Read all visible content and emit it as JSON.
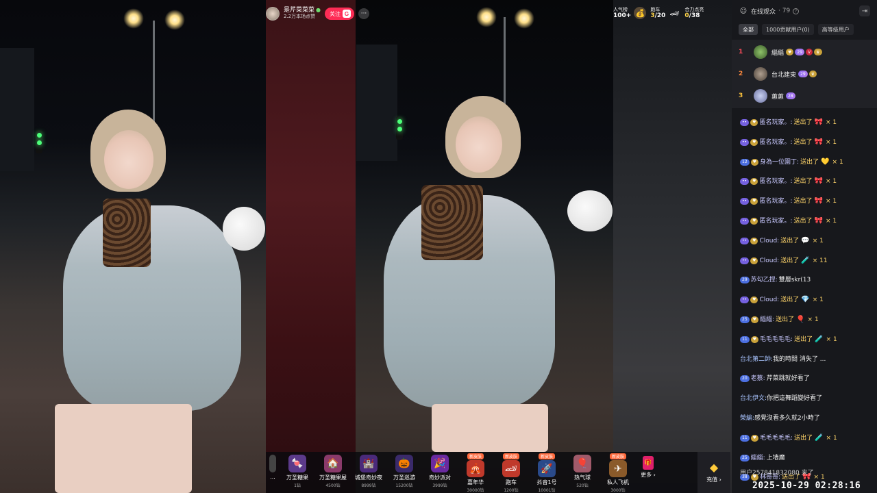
{
  "host": {
    "name": "是芹菜菜菜",
    "likes": "2.2万本场点赞",
    "follow_label": "关注",
    "follow_badge": "G"
  },
  "stats": {
    "popularity_label": "人气榜",
    "popularity_value": "100+",
    "car_label": "跑车",
    "car_value_current": "3",
    "car_value_total": "/20",
    "collab_label": "合力点亮",
    "collab_value_current": "0",
    "collab_value_total": "/38"
  },
  "gifts": [
    {
      "name": "...",
      "price": "",
      "icon": "gift-icon",
      "new": false
    },
    {
      "name": "万圣糖果",
      "price": "1钻",
      "icon": "candy-icon",
      "new": false
    },
    {
      "name": "万圣糖果屋",
      "price": "4500钻",
      "icon": "candy-house-icon",
      "new": false
    },
    {
      "name": "城堡奇妙夜",
      "price": "8999钻",
      "icon": "castle-icon",
      "new": false
    },
    {
      "name": "万圣巡游",
      "price": "15200钻",
      "icon": "parade-icon",
      "new": false
    },
    {
      "name": "奇妙派对",
      "price": "3999钻",
      "icon": "party-icon",
      "new": false
    },
    {
      "name": "嘉年华",
      "price": "30000钻",
      "icon": "carnival-icon",
      "new": true
    },
    {
      "name": "跑车",
      "price": "1200钻",
      "icon": "car-icon",
      "new": true
    },
    {
      "name": "抖音1号",
      "price": "10001钻",
      "icon": "rocket-icon",
      "new": true
    },
    {
      "name": "热气球",
      "price": "520钻",
      "icon": "balloon-icon",
      "new": false
    },
    {
      "name": "私人飞机",
      "price": "3000钻",
      "icon": "plane-icon",
      "new": true
    }
  ],
  "gift_new_label": "新皮肤",
  "more_label": "更多",
  "recharge_label": "充值",
  "panel": {
    "title": "在线观众",
    "count": "· 79",
    "tabs": [
      "全部",
      "1000贡献用户(0)",
      "高等级用户"
    ],
    "ranks": [
      {
        "num": "1",
        "name": "緇緇",
        "badge": "29"
      },
      {
        "num": "2",
        "name": "台北建東",
        "badge": "29"
      },
      {
        "num": "3",
        "name": "蕙蕙",
        "badge": "28"
      }
    ]
  },
  "chat": [
    {
      "name": "匿名玩家。:",
      "act": "送出了",
      "gift": "🎀",
      "count": "× 1",
      "lv": ""
    },
    {
      "name": "匿名玩家。:",
      "act": "送出了",
      "gift": "🎀",
      "count": "× 1",
      "lv": ""
    },
    {
      "name": "身為一位園丁:",
      "act": "送出了",
      "gift": "💛",
      "count": "× 1",
      "lv": "12"
    },
    {
      "name": "匿名玩家。:",
      "act": "送出了",
      "gift": "🎀",
      "count": "× 1",
      "lv": ""
    },
    {
      "name": "匿名玩家。:",
      "act": "送出了",
      "gift": "🎀",
      "count": "× 1",
      "lv": ""
    },
    {
      "name": "匿名玩家。:",
      "act": "送出了",
      "gift": "🎀",
      "count": "× 1",
      "lv": ""
    },
    {
      "name": "Cloud:",
      "act": "送出了",
      "gift": "💬",
      "count": "× 1",
      "lv": ""
    },
    {
      "name": "Cloud:",
      "act": "送出了",
      "gift": "🧪",
      "count": "× 11",
      "lv": ""
    },
    {
      "name": "苏勾乙捏:",
      "act": "",
      "gift": "",
      "count": "",
      "text": "雙層skr(13",
      "lv": "29"
    },
    {
      "name": "Cloud:",
      "act": "送出了",
      "gift": "💎",
      "count": "× 1",
      "lv": ""
    },
    {
      "name": "緇緇:",
      "act": "送出了",
      "gift": "🎈",
      "count": "× 1",
      "lv": "25"
    },
    {
      "name": "毛毛毛毛毛:",
      "act": "送出了",
      "gift": "🧪",
      "count": "× 1",
      "lv": "11"
    },
    {
      "name": "台北第二帥:",
      "act": "",
      "gift": "",
      "count": "",
      "text": "我的時間 消失了 ...",
      "lv": "plain"
    },
    {
      "name": "老蔡:",
      "act": "",
      "gift": "",
      "count": "",
      "text": "芹菜跳就好看了",
      "lv": "20"
    },
    {
      "name": "台北伊文:",
      "act": "",
      "gift": "",
      "count": "",
      "text": "你把這舞蹈變好看了",
      "lv": "plain"
    },
    {
      "name": "榮編:",
      "act": "",
      "gift": "",
      "count": "",
      "text": "感覺沒看多久就2小時了",
      "lv": "plain"
    },
    {
      "name": "毛毛毛毛毛:",
      "act": "送出了",
      "gift": "🧪",
      "count": "× 1",
      "lv": "11"
    },
    {
      "name": "緇緇:",
      "act": "",
      "gift": "",
      "count": "",
      "text": "上墙魔",
      "lv": "25"
    },
    {
      "name": "林哥哥:",
      "act": "送出了",
      "gift": "🎀",
      "count": "× 1",
      "lv": "38"
    }
  ],
  "footer_user": "用户257841832080 来了",
  "timestamp": "2025-10-29 02:28:16"
}
